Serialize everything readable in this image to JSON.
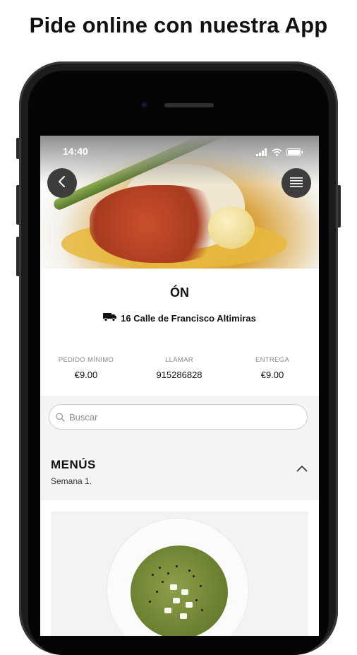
{
  "headline": "Pide online con nuestra App",
  "status_bar": {
    "time": "14:40"
  },
  "restaurant": {
    "name": "ÓN",
    "address": "16 Calle de Francisco Altimiras"
  },
  "stats": [
    {
      "label": "PEDIDO MÍNIMO",
      "value": "€9.00"
    },
    {
      "label": "LLAMAR",
      "value": "915286828"
    },
    {
      "label": "ENTREGA",
      "value": "€9.00"
    }
  ],
  "search": {
    "placeholder": "Buscar"
  },
  "menu_section": {
    "title": "MENÚS",
    "subtitle": "Semana 1."
  },
  "icons": {
    "back": "chevron-left-icon",
    "menu": "list-icon",
    "truck": "truck-icon",
    "search": "search-icon",
    "collapse": "chevron-up-icon"
  },
  "colors": {
    "hero_button": "#3d3d3d",
    "background_gray": "#f4f4f4"
  }
}
